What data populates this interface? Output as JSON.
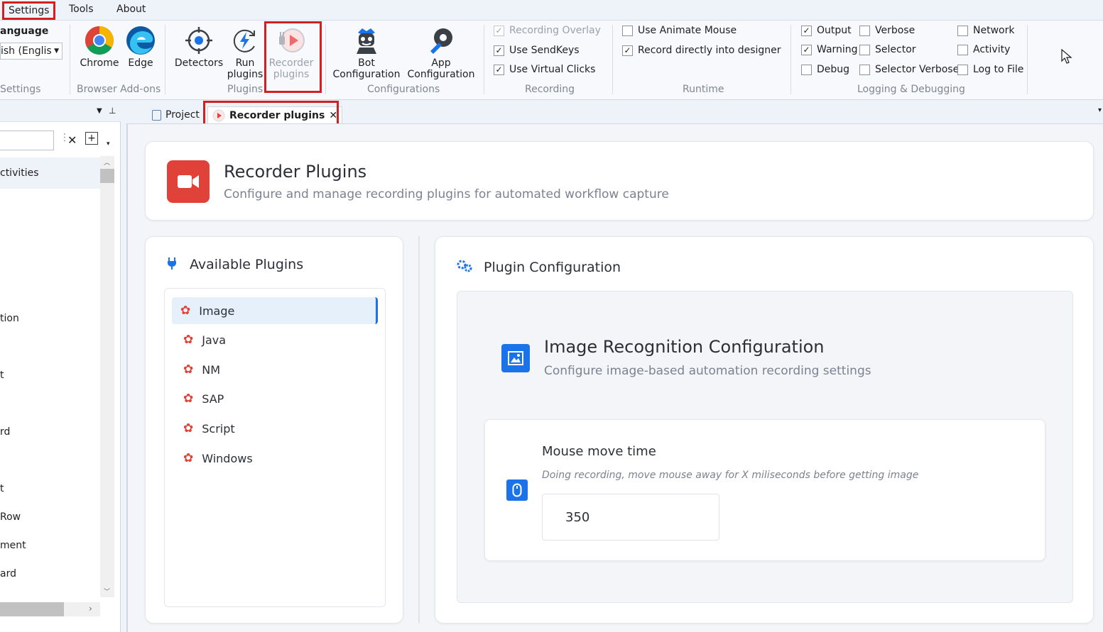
{
  "menu": {
    "settings": "Settings",
    "tools": "Tools",
    "about": "About"
  },
  "ribbon": {
    "language_label": "anguage",
    "language_value": "ish (Englis",
    "settings_group": "Settings",
    "browser_group": "Browser Add-ons",
    "chrome": "Chrome",
    "edge": "Edge",
    "detectors": "Detectors",
    "run_plugins_1": "Run",
    "run_plugins_2": "plugins",
    "recorder_plugins_1": "Recorder",
    "recorder_plugins_2": "plugins",
    "plugins_group": "Plugins",
    "bot_config_1": "Bot",
    "bot_config_2": "Configuration",
    "app_config_1": "App",
    "app_config_2": "Configuration",
    "configurations_group": "Configurations",
    "recording_overlay": "Recording Overlay",
    "use_sendkeys": "Use SendKeys",
    "use_virtual_clicks": "Use Virtual Clicks",
    "recording_group": "Recording",
    "use_animate_mouse": "Use Animate Mouse",
    "record_into_designer": "Record directly into designer",
    "runtime_group": "Runtime",
    "output": "Output",
    "warning": "Warning",
    "debug": "Debug",
    "verbose": "Verbose",
    "selector": "Selector",
    "selector_verbose": "Selector Verbose",
    "network": "Network",
    "activity": "Activity",
    "log_to_file": "Log to File",
    "logging_group": "Logging & Debugging",
    "checked": "✓"
  },
  "left_panel": {
    "items": [
      "ctivities",
      "tion",
      "t",
      "rd",
      "t",
      "Row",
      "ment",
      "ard"
    ]
  },
  "tabs": {
    "project": "Project",
    "recorder": "Recorder plugins",
    "close": "✕"
  },
  "header": {
    "title": "Recorder Plugins",
    "subtitle": "Configure and manage recording plugins for automated workflow capture"
  },
  "plugins_panel": {
    "title": "Available Plugins",
    "items": [
      "Image",
      "Java",
      "NM",
      "SAP",
      "Script",
      "Windows"
    ]
  },
  "config_panel": {
    "title": "Plugin Configuration",
    "section_title": "Image Recognition Configuration",
    "section_subtitle": "Configure image-based automation recording settings",
    "field_label": "Mouse move time",
    "field_help": "Doing recording, move mouse away for X miliseconds before getting image",
    "field_value": "350"
  },
  "colors": {
    "accent": "#1a73e8",
    "red": "#e0423a",
    "highlight": "#d21f1f"
  }
}
